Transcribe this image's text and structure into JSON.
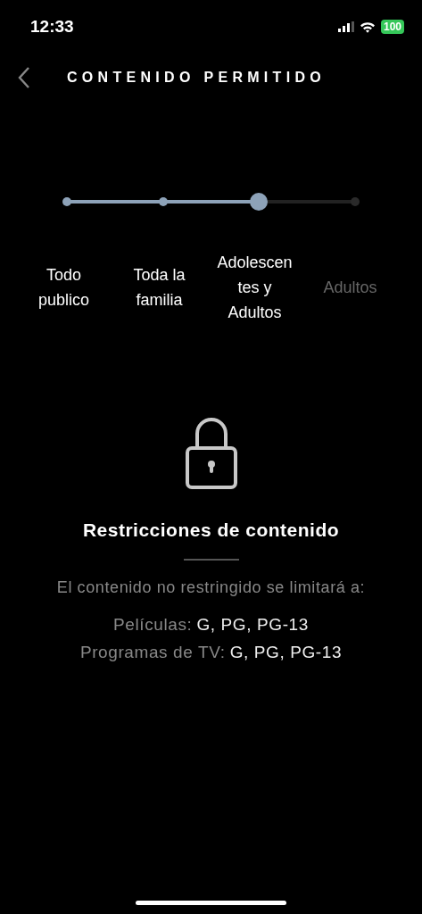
{
  "status_bar": {
    "time": "12:33",
    "battery": "100"
  },
  "header": {
    "title": "CONTENIDO PERMITIDO"
  },
  "slider": {
    "level": 0.66,
    "stops": [
      {
        "label": "Todo publico",
        "selected": false
      },
      {
        "label": "Toda la familia",
        "selected": false
      },
      {
        "label": "Adolescentes y Adultos",
        "selected": true
      },
      {
        "label": "Adultos",
        "selected": false
      }
    ]
  },
  "restrictions": {
    "title": "Restricciones de contenido",
    "description": "El contenido no restringido se limitará a:",
    "rows": [
      {
        "label": "Películas:",
        "value": "G, PG, PG-13"
      },
      {
        "label": "Programas de TV:",
        "value": "G, PG, PG-13"
      }
    ]
  }
}
